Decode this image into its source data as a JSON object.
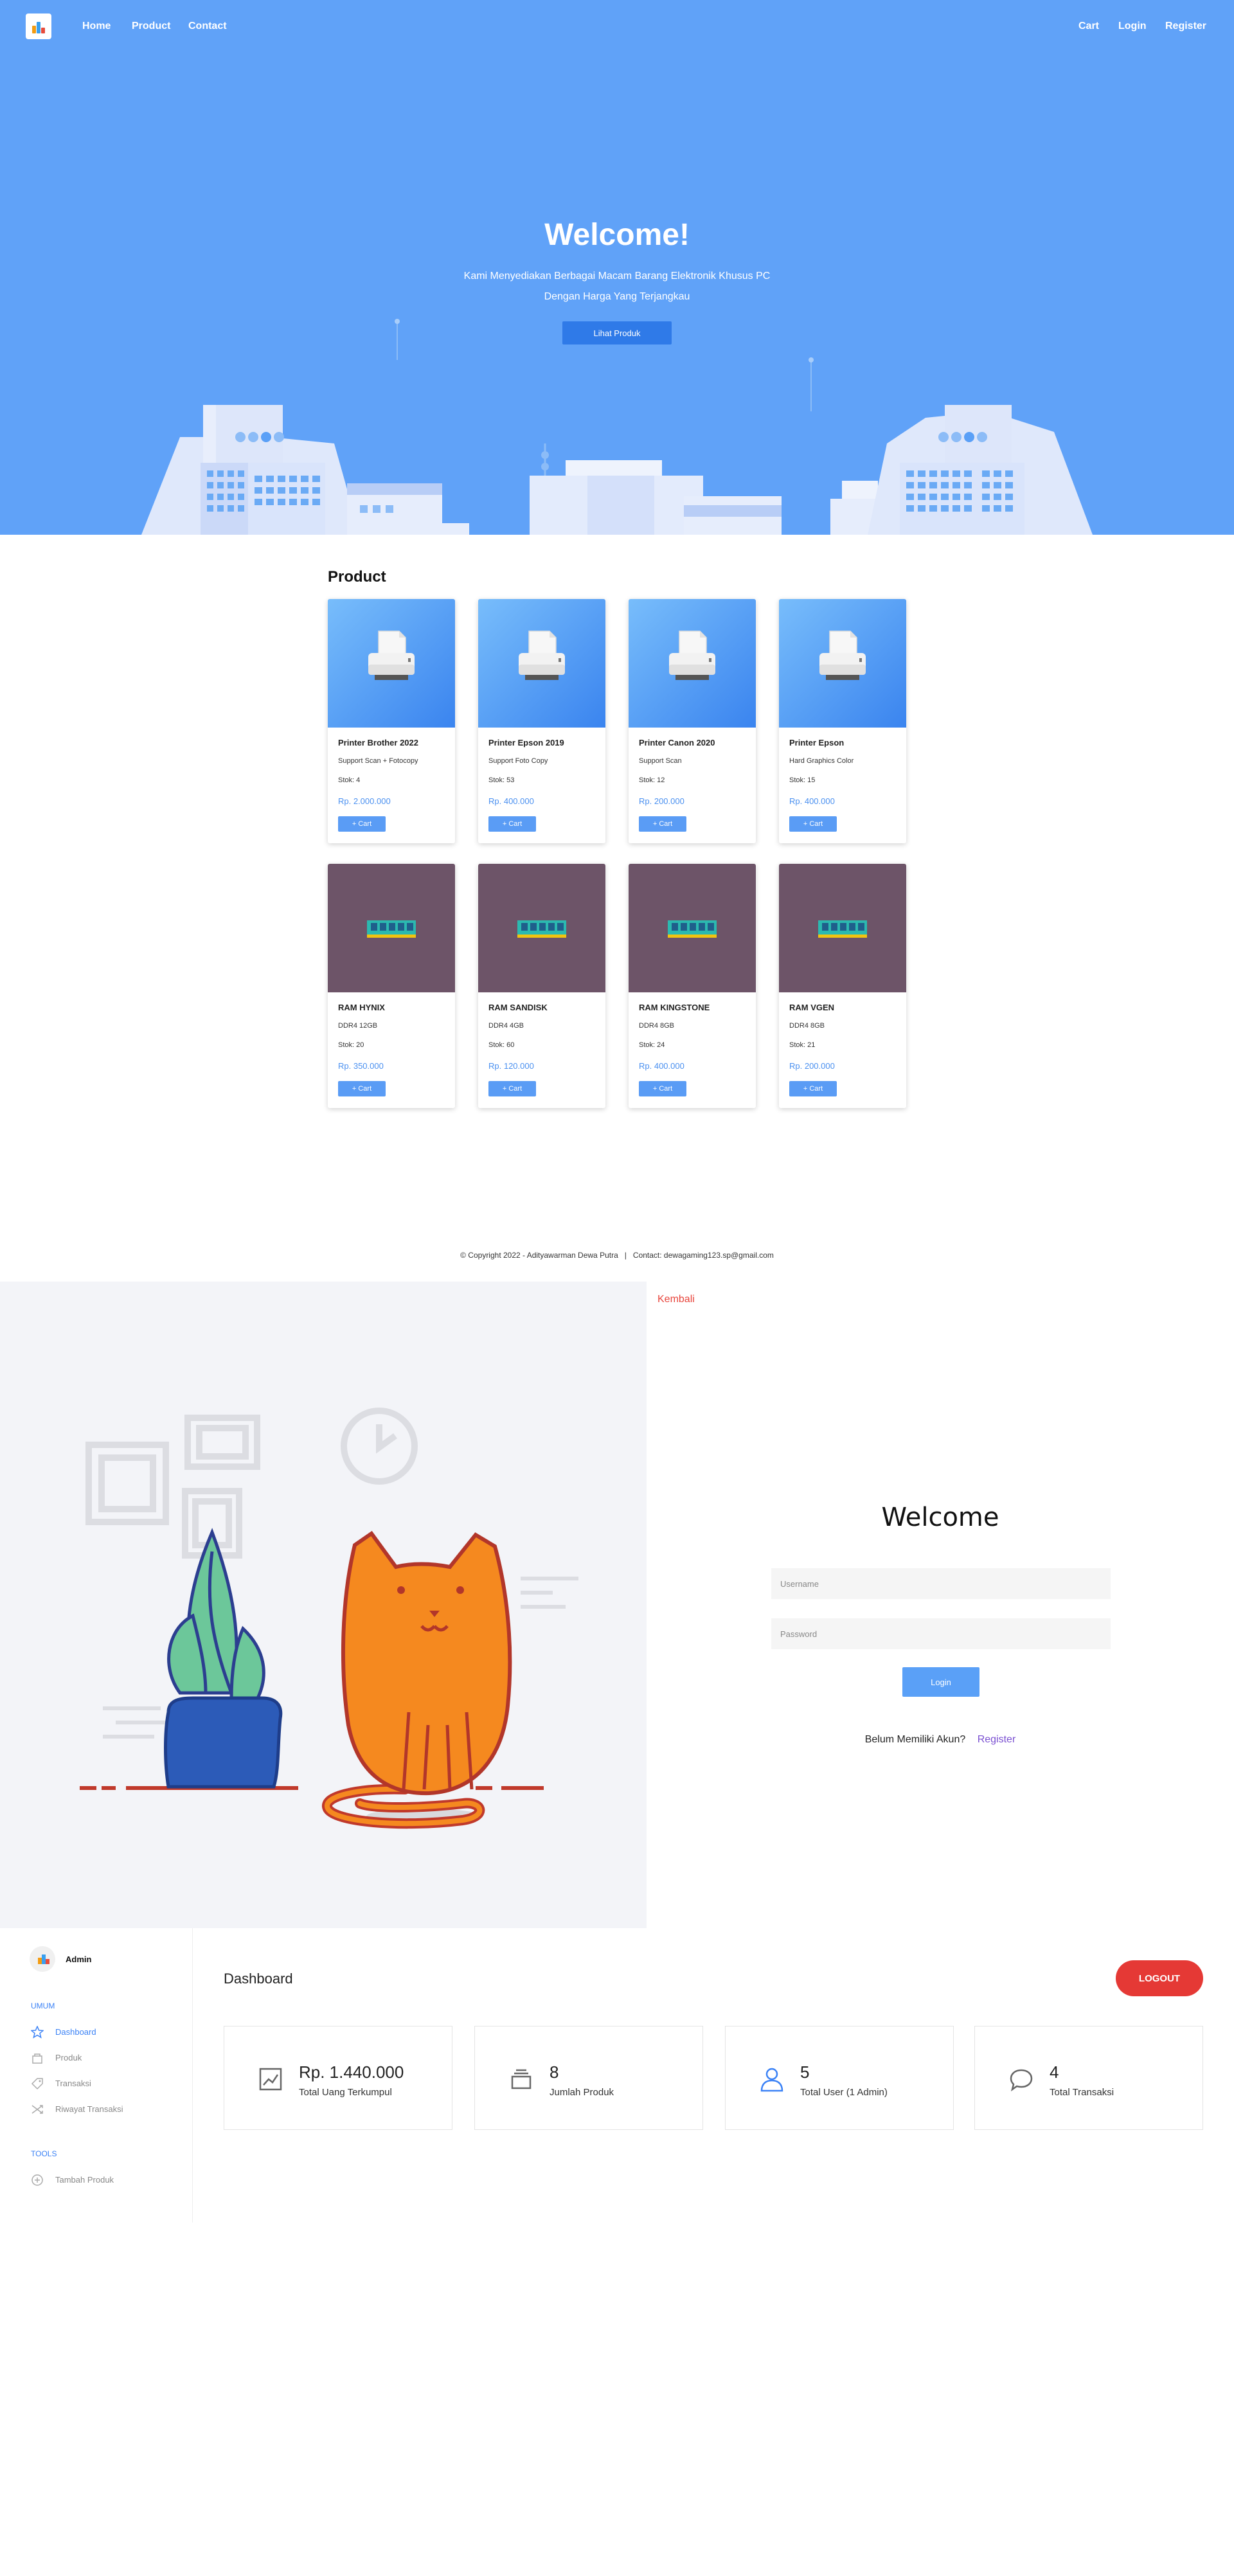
{
  "nav": {
    "links": [
      "Home",
      "Product",
      "Contact"
    ],
    "right_links": [
      "Cart",
      "Login",
      "Register"
    ]
  },
  "hero": {
    "title": "Welcome!",
    "subtitle_line1": "Kami Menyediakan Berbagai Macam Barang Elektronik Khusus PC",
    "subtitle_line2": "Dengan Harga Yang Terjangkau",
    "button": "Lihat Produk"
  },
  "products": {
    "title": "Product",
    "cart_label": "+ Cart",
    "items": [
      {
        "name": "Printer Brother 2022",
        "desc": "Support Scan + Fotocopy",
        "stock": "Stok: 4",
        "price": "Rp. 2.000.000",
        "image": "printer-image"
      },
      {
        "name": "Printer Epson 2019",
        "desc": "Support Foto Copy",
        "stock": "Stok: 53",
        "price": "Rp. 400.000",
        "image": "printer-image"
      },
      {
        "name": "Printer Canon 2020",
        "desc": "Support Scan",
        "stock": "Stok: 12",
        "price": "Rp. 200.000",
        "image": "printer-image"
      },
      {
        "name": "Printer Epson",
        "desc": "Hard Graphics Color",
        "stock": "Stok: 15",
        "price": "Rp. 400.000",
        "image": "printer-image"
      },
      {
        "name": "RAM HYNIX",
        "desc": "DDR4 12GB",
        "stock": "Stok: 20",
        "price": "Rp. 350.000",
        "image": "ram-image"
      },
      {
        "name": "RAM SANDISK",
        "desc": "DDR4 4GB",
        "stock": "Stok: 60",
        "price": "Rp. 120.000",
        "image": "ram-image"
      },
      {
        "name": "RAM KINGSTONE",
        "desc": "DDR4 8GB",
        "stock": "Stok: 24",
        "price": "Rp. 400.000",
        "image": "ram-image"
      },
      {
        "name": "RAM VGEN",
        "desc": "DDR4 8GB",
        "stock": "Stok: 21",
        "price": "Rp. 200.000",
        "image": "ram-image"
      }
    ]
  },
  "footer": {
    "copyright": "© Copyright 2022 - Adityawarman Dewa Putra",
    "separator": "|",
    "contact": "Contact: dewagaming123.sp@gmail.com"
  },
  "login": {
    "back": "Kembali",
    "title": "Welcome",
    "username_placeholder": "Username",
    "password_placeholder": "Password",
    "button": "Login",
    "no_account": "Belum Memiliki Akun?",
    "register": "Register"
  },
  "dashboard": {
    "user": "Admin",
    "section_general": "UMUM",
    "menu": [
      "Dashboard",
      "Produk",
      "Transaksi",
      "Riwayat Transaksi"
    ],
    "section_tools": "TOOLS",
    "tools": [
      "Tambah Produk"
    ],
    "title": "Dashboard",
    "logout": "LOGOUT",
    "stats": [
      {
        "value": "Rp. 1.440.000",
        "label": "Total Uang Terkumpul",
        "icon": "chart-icon"
      },
      {
        "value": "8",
        "label": "Jumlah Produk",
        "icon": "box-icon"
      },
      {
        "value": "5",
        "label": "Total User (1 Admin)",
        "icon": "user-icon"
      },
      {
        "value": "4",
        "label": "Total Transaksi",
        "icon": "chat-icon"
      }
    ]
  },
  "colors": {
    "hero_bg": "#60a2f8",
    "accent": "#3b82f6",
    "logout": "#e53935",
    "back_link": "#e8453c",
    "register_link": "#7a4fd1"
  }
}
